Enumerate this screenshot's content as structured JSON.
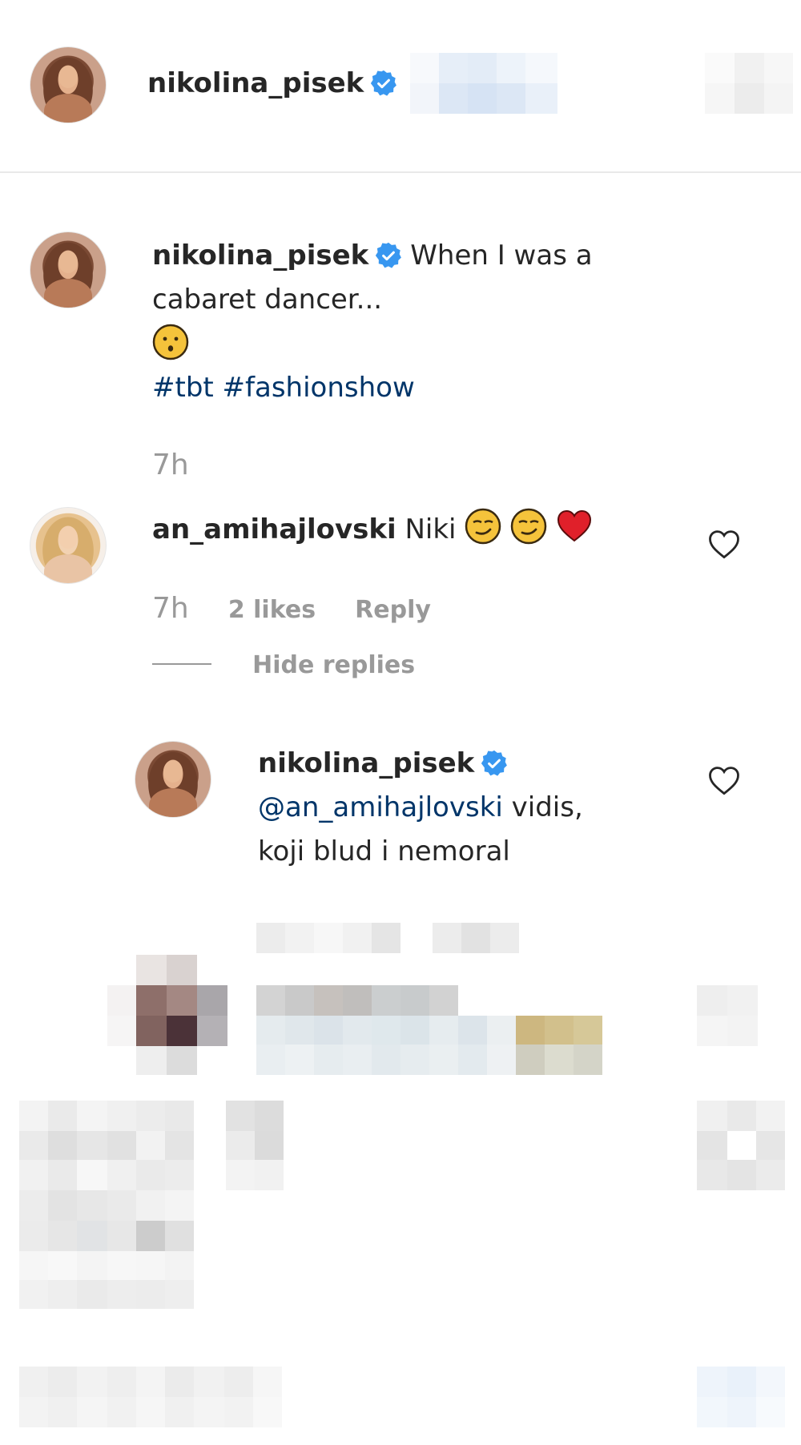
{
  "header": {
    "username": "nikolina_pisek"
  },
  "caption": {
    "username": "nikolina_pisek",
    "text_line1": "When I was a",
    "text_line2": "cabaret dancer...",
    "emoji": "face-emoji",
    "hashtags": "#tbt #fashionshow",
    "time": "7h"
  },
  "comment1": {
    "username": "an_amihajlovski",
    "text": "Niki",
    "emojis": [
      "smirk-emoji",
      "smirk-emoji",
      "red-heart-emoji"
    ],
    "time": "7h",
    "likes": "2 likes",
    "reply_label": "Reply",
    "hide_replies_label": "Hide replies"
  },
  "reply1": {
    "username": "nikolina_pisek",
    "mention": "@an_amihajlovski",
    "text_line1_rest": " vidis,",
    "text_line2": "koji blud i nemoral"
  },
  "colors": {
    "verified_blue": "#3897f0",
    "text": "#262626",
    "meta_gray": "#999999",
    "hashtag_blue": "#003569",
    "divider": "#e9e9e9"
  },
  "icons": [
    "verified-badge-icon",
    "heart-outline-icon"
  ]
}
